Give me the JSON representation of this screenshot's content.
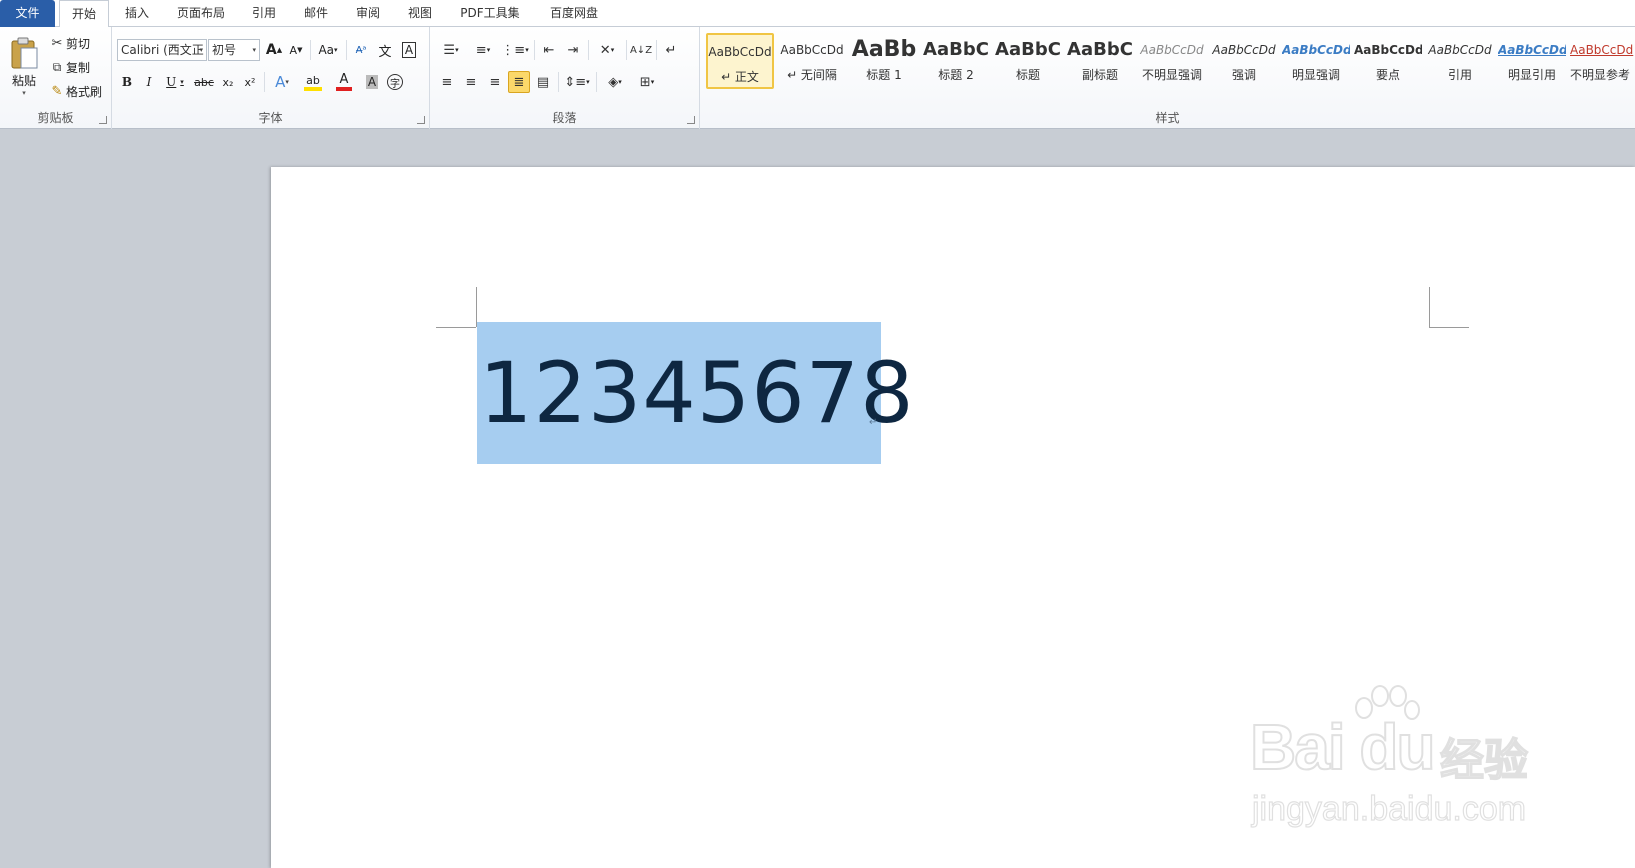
{
  "tabs": [
    {
      "label": "文件"
    },
    {
      "label": "开始"
    },
    {
      "label": "插入"
    },
    {
      "label": "页面布局"
    },
    {
      "label": "引用"
    },
    {
      "label": "邮件"
    },
    {
      "label": "审阅"
    },
    {
      "label": "视图"
    },
    {
      "label": "PDF工具集"
    },
    {
      "label": "百度网盘"
    }
  ],
  "clipboard": {
    "group_label": "剪贴板",
    "paste_label": "粘贴",
    "cut_label": "剪切",
    "copy_label": "复制",
    "format_painter_label": "格式刷"
  },
  "font": {
    "group_label": "字体",
    "font_name": "Calibri (西文正",
    "font_size": "初号",
    "change_case_label": "Aa",
    "bold": "B",
    "italic": "I",
    "underline": "U",
    "strike": "abc",
    "subscript": "x₂",
    "superscript": "x²",
    "text_effect": "A",
    "highlight": "ab",
    "font_color": "A",
    "char_shading": "A",
    "enclose": "字",
    "grow": "A",
    "shrink": "A",
    "phonetic": "文",
    "char_border": "A"
  },
  "paragraph": {
    "group_label": "段落"
  },
  "styles": {
    "group_label": "样式",
    "items": [
      {
        "sample": "AaBbCcDd",
        "name": "↵ 正文"
      },
      {
        "sample": "AaBbCcDd",
        "name": "↵ 无间隔"
      },
      {
        "sample": "AaBb",
        "name": "标题 1"
      },
      {
        "sample": "AaBbC",
        "name": "标题 2"
      },
      {
        "sample": "AaBbC",
        "name": "标题"
      },
      {
        "sample": "AaBbC",
        "name": "副标题"
      },
      {
        "sample": "AaBbCcDd",
        "name": "不明显强调"
      },
      {
        "sample": "AaBbCcDd",
        "name": "强调"
      },
      {
        "sample": "AaBbCcDd",
        "name": "明显强调"
      },
      {
        "sample": "AaBbCcDd",
        "name": "要点"
      },
      {
        "sample": "AaBbCcDd",
        "name": "引用"
      },
      {
        "sample": "AaBbCcDd",
        "name": "明显引用"
      },
      {
        "sample": "AaBbCcDd",
        "name": "不明显参考"
      }
    ]
  },
  "document": {
    "text": "12345678",
    "paragraph_mark": "↵"
  },
  "watermark": {
    "brand": "Bai du",
    "cn": "经验",
    "url": "jingyan.baidu.com"
  },
  "colors": {
    "file_tab": "#2a5ea8",
    "selection": "#a6cdf0",
    "text": "#0e2741",
    "highlight_yellow": "#ffe000",
    "font_red": "#e02020"
  }
}
